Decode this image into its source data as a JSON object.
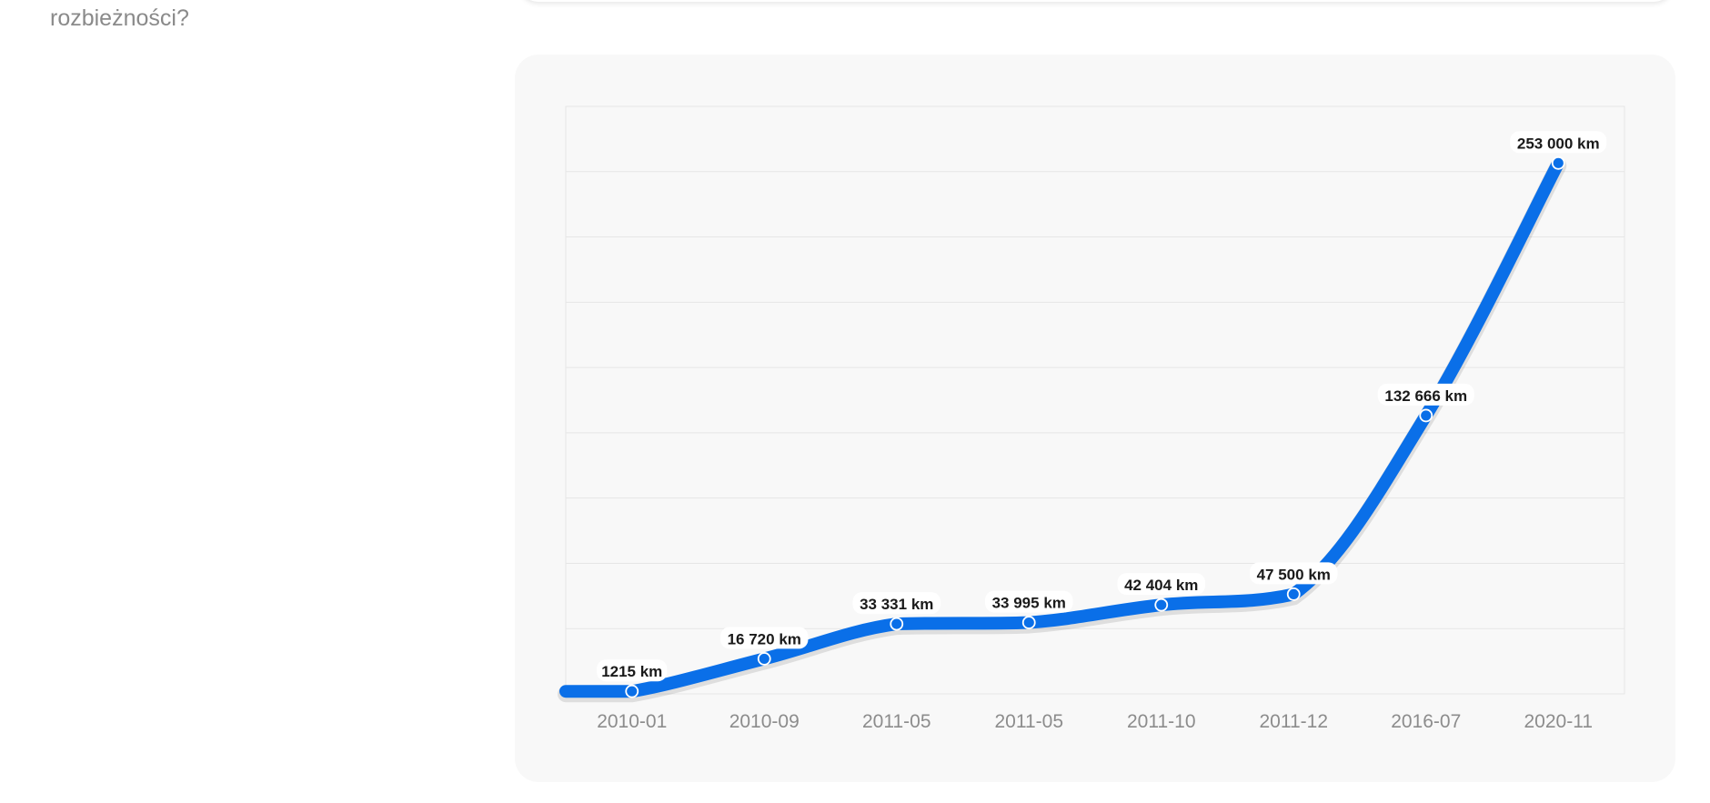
{
  "page": {
    "question_fragment": "rozbieżności?"
  },
  "chart_data": {
    "type": "line",
    "title": "",
    "xlabel": "",
    "ylabel": "",
    "categories": [
      "2010-01",
      "2010-09",
      "2011-05",
      "2011-05",
      "2011-10",
      "2011-12",
      "2016-07",
      "2020-11"
    ],
    "values": [
      1215,
      16720,
      33331,
      33995,
      42404,
      47500,
      132666,
      253000
    ],
    "data_labels": [
      "1215 km",
      "16 720 km",
      "33 331 km",
      "33 995 km",
      "42 404 km",
      "47 500 km",
      "132 666 km",
      "253 000 km"
    ],
    "ylim": [
      0,
      280000
    ],
    "grid": true,
    "smooth": true,
    "color": "#0a6fe8"
  }
}
